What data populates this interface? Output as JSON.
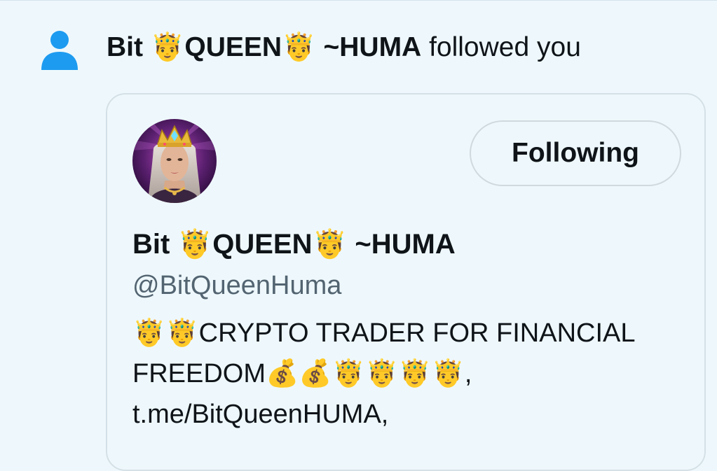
{
  "notification": {
    "icon": "person-icon",
    "user_name": "Bit 🤴QUEEN🤴 ~HUMA",
    "action_text": "followed you"
  },
  "user_card": {
    "avatar": "queen-avatar",
    "follow_button_label": "Following",
    "display_name": "Bit 🤴QUEEN🤴 ~HUMA",
    "handle": "@BitQueenHuma",
    "bio": "🤴🤴CRYPTO TRADER FOR FINANCIAL FREEDOM💰💰🤴🤴🤴🤴, t.me/BitQueenHUMA,"
  },
  "colors": {
    "background": "#eef8fc",
    "accent_icon": "#1d9bf0",
    "text_primary": "#0f1419",
    "text_secondary": "#536471",
    "border": "#cfd9de"
  }
}
